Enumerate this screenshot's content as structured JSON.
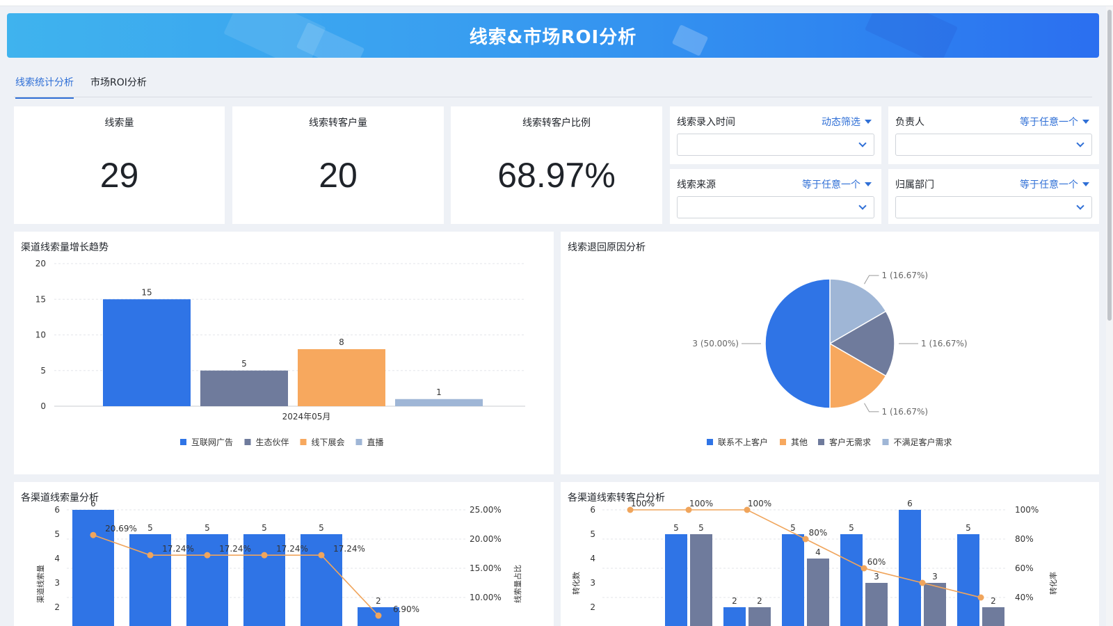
{
  "banner": {
    "title": "线索&市场ROI分析"
  },
  "tabs": [
    {
      "label": "线索统计分析",
      "active": true
    },
    {
      "label": "市场ROI分析",
      "active": false
    }
  ],
  "kpis": [
    {
      "title": "线索量",
      "value": "29"
    },
    {
      "title": "线索转客户量",
      "value": "20"
    },
    {
      "title": "线索转客户比例",
      "value": "68.97%"
    }
  ],
  "filters": [
    {
      "label": "线索录入时间",
      "mode": "动态筛选",
      "value": ""
    },
    {
      "label": "负责人",
      "mode": "等于任意一个",
      "value": ""
    },
    {
      "label": "线索来源",
      "mode": "等于任意一个",
      "value": ""
    },
    {
      "label": "归属部门",
      "mode": "等于任意一个",
      "value": ""
    }
  ],
  "colors": {
    "accent": "#2f6fd6",
    "blue": "#2f74e6",
    "slate": "#6f7b9c",
    "orange": "#f7a85e",
    "lightblue": "#9fb6d6"
  },
  "chart_data": [
    {
      "id": "trend",
      "type": "bar",
      "title": "渠道线索量增长趋势",
      "categories": [
        "2024年05月"
      ],
      "series": [
        {
          "name": "互联网广告",
          "values": [
            15
          ],
          "color": "#2f74e6"
        },
        {
          "name": "生态伙伴",
          "values": [
            5
          ],
          "color": "#6f7b9c"
        },
        {
          "name": "线下展会",
          "values": [
            8
          ],
          "color": "#f7a85e"
        },
        {
          "name": "直播",
          "values": [
            1
          ],
          "color": "#9fb6d6"
        }
      ],
      "ylim": [
        0,
        20
      ],
      "yticks": [
        "0",
        "5",
        "10",
        "15",
        "20"
      ],
      "grid": true,
      "legend": "bottom"
    },
    {
      "id": "pie",
      "type": "pie",
      "title": "线索退回原因分析",
      "slices": [
        {
          "name": "不满足客户需求",
          "value": 1,
          "label": "1 (16.67%)",
          "color": "#9fb6d6"
        },
        {
          "name": "客户无需求",
          "value": 1,
          "label": "1 (16.67%)",
          "color": "#6f7b9c"
        },
        {
          "name": "其他",
          "value": 1,
          "label": "1 (16.67%)",
          "color": "#f7a85e"
        },
        {
          "name": "联系不上客户",
          "value": 3,
          "label": "3 (50.00%)",
          "color": "#2f74e6"
        }
      ],
      "legend_order": [
        "联系不上客户",
        "其他",
        "客户无需求",
        "不满足客户需求"
      ],
      "legend": "bottom"
    },
    {
      "id": "channel_volume",
      "type": "bar",
      "title": "各渠道线索量分析",
      "ylabel": "渠道线索量",
      "y2label": "线索量占比",
      "bar_values": [
        6,
        5,
        5,
        5,
        5,
        2
      ],
      "line_values": [
        20.69,
        17.24,
        17.24,
        17.24,
        17.24,
        6.9
      ],
      "line_labels": [
        "20.69%",
        "17.24%",
        "17.24%",
        "17.24%",
        "17.24%",
        "6.90%"
      ],
      "y_visible_ticks": [
        "2",
        "3",
        "4",
        "5",
        "6"
      ],
      "y2_visible_ticks": [
        "10.00%",
        "15.00%",
        "20.00%",
        "25.00%"
      ]
    },
    {
      "id": "channel_conversion",
      "type": "bar",
      "title": "各渠道线索转客户分析",
      "ylabel": "转化数",
      "y2label": "转化率",
      "groups": [
        {
          "a": null,
          "b": null,
          "rate": 100,
          "rate_label": "100%"
        },
        {
          "a": 5,
          "b": 5,
          "rate": 100,
          "rate_label": "100%"
        },
        {
          "a": 2,
          "b": 2,
          "rate": 100,
          "rate_label": "100%"
        },
        {
          "a": 5,
          "b": 4,
          "rate": 80,
          "rate_label": "80%"
        },
        {
          "a": 5,
          "b": 3,
          "rate": 60,
          "rate_label": "60%"
        },
        {
          "a": 6,
          "b": 3,
          "rate": 50,
          "rate_label": ""
        },
        {
          "a": 5,
          "b": 2,
          "rate": 40,
          "rate_label": ""
        }
      ],
      "y_visible_ticks": [
        "2",
        "3",
        "4",
        "5",
        "6"
      ],
      "y2_visible_ticks": [
        "40%",
        "60%",
        "80%",
        "100%"
      ]
    }
  ]
}
